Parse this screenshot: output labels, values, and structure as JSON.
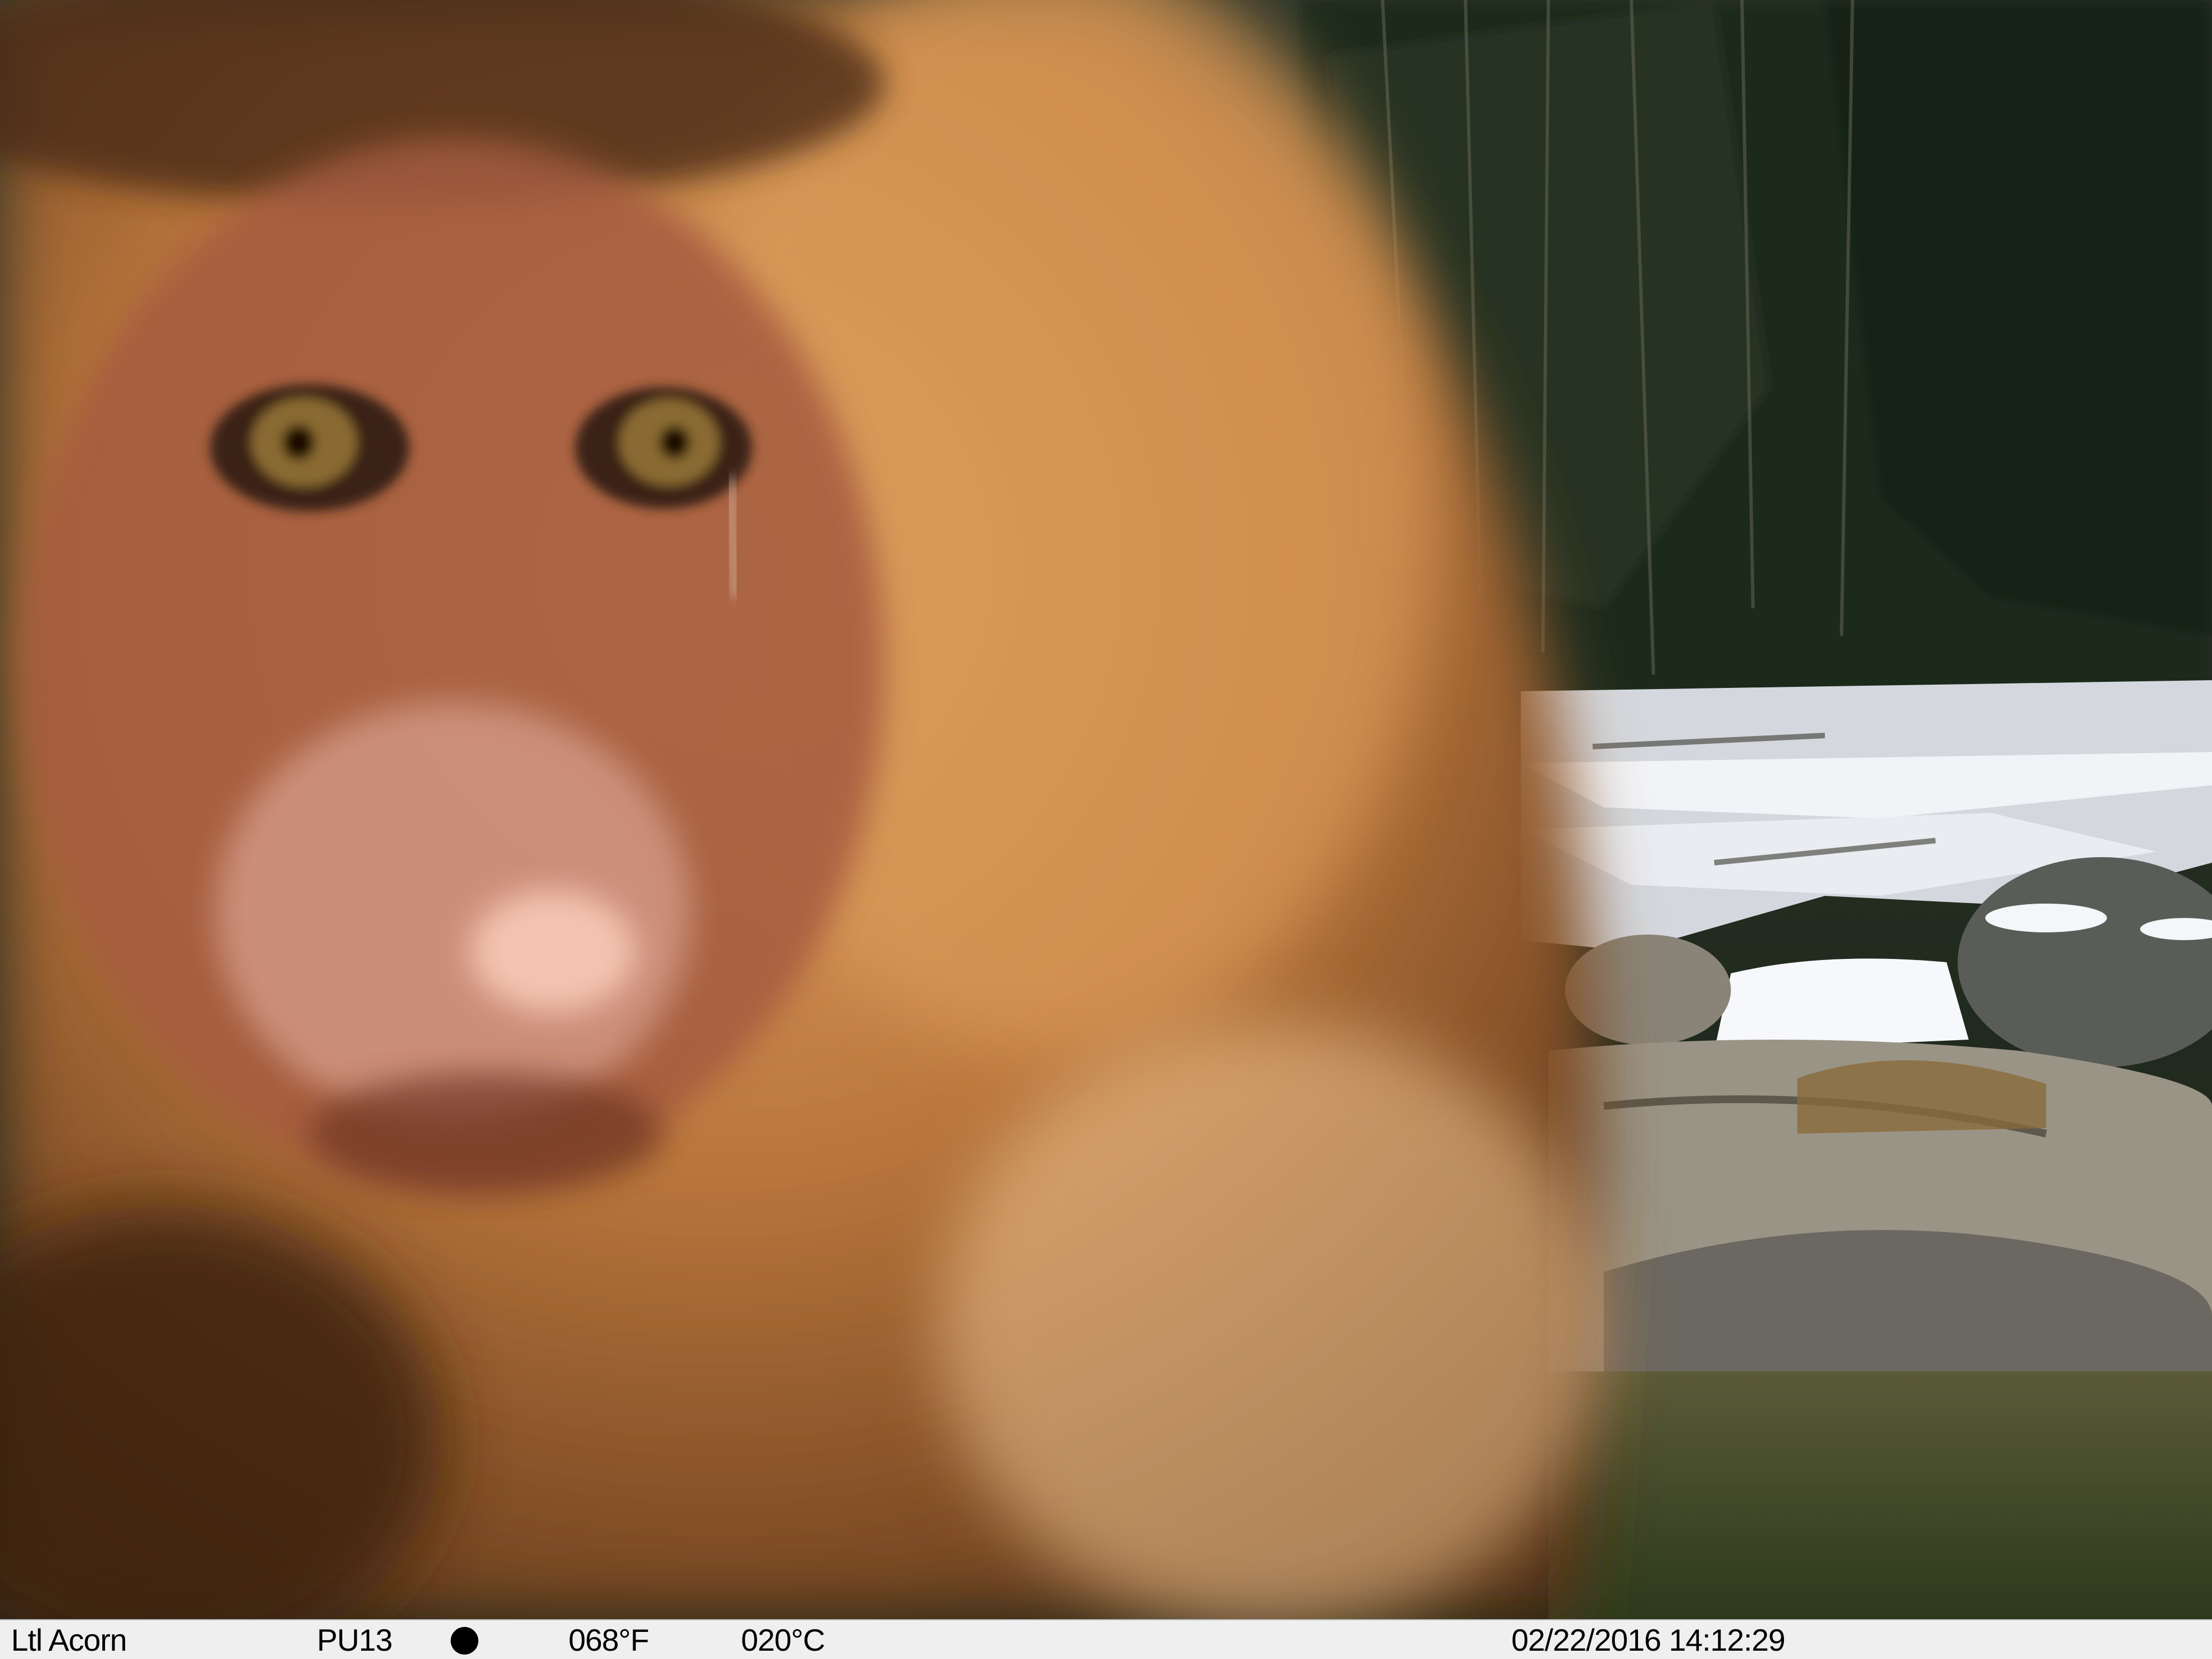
{
  "scene": {
    "subject": "macaque-face-closeup",
    "setting": "snowy-riverbank-with-forest",
    "colors": {
      "fur": "#c98a4a",
      "fur_highlight": "#f2c890",
      "forest": "#1c2a1c",
      "snow": "#f4f6fa",
      "rock": "#8a8478",
      "water": "#3b4526"
    }
  },
  "camera_strip": {
    "brand": "Ltl Acorn",
    "camera_id": "PU13",
    "moon_phase_icon": "moon-full-icon",
    "temp_f": "068°F",
    "temp_c": "020°C",
    "datetime": "02/22/2016 14:12:29",
    "background": "#efefef"
  }
}
